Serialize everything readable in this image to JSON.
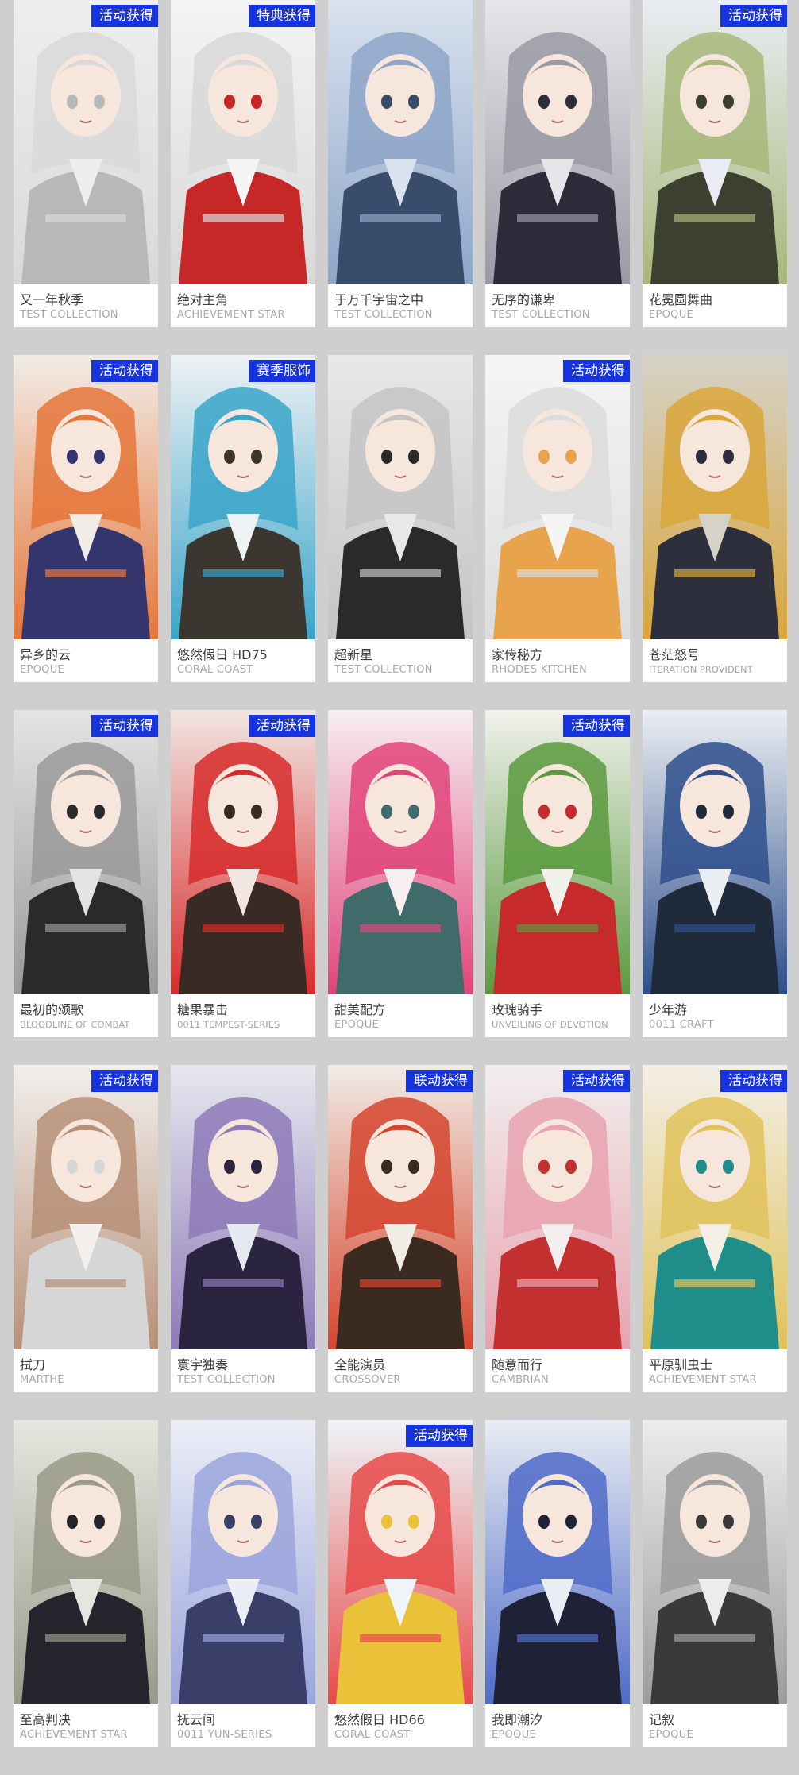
{
  "colors": {
    "background": "#cfcfcf",
    "card": "#ffffff",
    "badge": "#1534e0",
    "name_text": "#3a3a3a",
    "brand_text": "#a7a7a7"
  },
  "outfits": [
    {
      "name": "又一年秋季",
      "brand": "TEST COLLECTION",
      "badge": "活动获得",
      "palette": [
        "#eeeeee",
        "#d9d9d9",
        "#b8b8b8"
      ]
    },
    {
      "name": "绝对主角",
      "brand": "ACHIEVEMENT STAR",
      "badge": "特典获得",
      "palette": [
        "#f4f4f4",
        "#d8d8d8",
        "#c62828"
      ]
    },
    {
      "name": "于万千宇宙之中",
      "brand": "TEST COLLECTION",
      "badge": "",
      "palette": [
        "#d9e2ef",
        "#8ea6c8",
        "#3a4c6b"
      ]
    },
    {
      "name": "无序的谦卑",
      "brand": "TEST COLLECTION",
      "badge": "",
      "palette": [
        "#e6e6ea",
        "#9a9aa5",
        "#2c2c3a"
      ]
    },
    {
      "name": "花冕圆舞曲",
      "brand": "EPOQUE",
      "badge": "活动获得",
      "palette": [
        "#e9edf3",
        "#a8b77a",
        "#3d4030"
      ]
    },
    {
      "name": "异乡的云",
      "brand": "EPOQUE",
      "badge": "活动获得",
      "palette": [
        "#f1ece6",
        "#e5763a",
        "#35356e"
      ]
    },
    {
      "name": "悠然假日 HD75",
      "brand": "CORAL COAST",
      "badge": "赛季服饰",
      "palette": [
        "#eef2f5",
        "#3aa4c9",
        "#3b3630"
      ]
    },
    {
      "name": "超新星",
      "brand": "TEST COLLECTION",
      "badge": "",
      "palette": [
        "#e8e8e8",
        "#c4c4c4",
        "#2a2a2a"
      ]
    },
    {
      "name": "家传秘方",
      "brand": "RHODES KITCHEN",
      "badge": "活动获得",
      "palette": [
        "#f5f5f5",
        "#dcdcdc",
        "#e7a44d"
      ]
    },
    {
      "name": "苍茫怒号",
      "brand": "ITERATION PROVIDENT",
      "badge": "",
      "palette": [
        "#d6d2c8",
        "#d9a63a",
        "#2d2f3d"
      ]
    },
    {
      "name": "最初的颂歌",
      "brand": "BLOODLINE OF COMBAT",
      "badge": "活动获得",
      "palette": [
        "#e4e4e4",
        "#9a9a9a",
        "#2a2a2a"
      ]
    },
    {
      "name": "糖果暴击",
      "brand": "0011 TEMPEST-SERIES",
      "badge": "活动获得",
      "palette": [
        "#f1e6e2",
        "#d72b2b",
        "#3a2a24"
      ]
    },
    {
      "name": "甜美配方",
      "brand": "EPOQUE",
      "badge": "",
      "palette": [
        "#f7eef1",
        "#e0447a",
        "#3f6b6b"
      ]
    },
    {
      "name": "玫瑰骑手",
      "brand": "UNVEILING OF DEVOTION",
      "badge": "活动获得",
      "palette": [
        "#f1f1ec",
        "#5a9a3e",
        "#c62a2a"
      ]
    },
    {
      "name": "少年游",
      "brand": "0011 CRAFT",
      "badge": "",
      "palette": [
        "#ebeef2",
        "#2e4f8c",
        "#1f2a3a"
      ]
    },
    {
      "name": "拭刀",
      "brand": "MARTHE",
      "badge": "活动获得",
      "palette": [
        "#f2efec",
        "#b79078",
        "#d6d6d6"
      ]
    },
    {
      "name": "寰宇独奏",
      "brand": "TEST COLLECTION",
      "badge": "",
      "palette": [
        "#e6e8ef",
        "#8d7ab7",
        "#2b2440"
      ]
    },
    {
      "name": "全能演员",
      "brand": "CROSSOVER",
      "badge": "联动获得",
      "palette": [
        "#f1ece6",
        "#d5452e",
        "#3b2a20"
      ]
    },
    {
      "name": "随意而行",
      "brand": "CAMBRIAN",
      "badge": "活动获得",
      "palette": [
        "#f2eeee",
        "#e7a3b0",
        "#c23030"
      ]
    },
    {
      "name": "平原驯虫士",
      "brand": "ACHIEVEMENT STAR",
      "badge": "活动获得",
      "palette": [
        "#f3efe6",
        "#e0c25a",
        "#1f8d8a"
      ]
    },
    {
      "name": "至高判决",
      "brand": "ACHIEVEMENT STAR",
      "badge": "",
      "palette": [
        "#e6e6e0",
        "#9a9a8a",
        "#24242c"
      ]
    },
    {
      "name": "抚云间",
      "brand": "0011 YUN-SERIES",
      "badge": "",
      "palette": [
        "#eceef6",
        "#9aa5dc",
        "#3a3f6a"
      ]
    },
    {
      "name": "悠然假日 HD66",
      "brand": "CORAL COAST",
      "badge": "活动获得",
      "palette": [
        "#eef4f7",
        "#e84a4a",
        "#e9c23a"
      ]
    },
    {
      "name": "我即潮汐",
      "brand": "EPOQUE",
      "badge": "",
      "palette": [
        "#e9ecf3",
        "#4f6bc8",
        "#1f2236"
      ]
    },
    {
      "name": "记叙",
      "brand": "EPOQUE",
      "badge": "",
      "palette": [
        "#ececec",
        "#9c9c9c",
        "#3a3a3a"
      ]
    }
  ]
}
